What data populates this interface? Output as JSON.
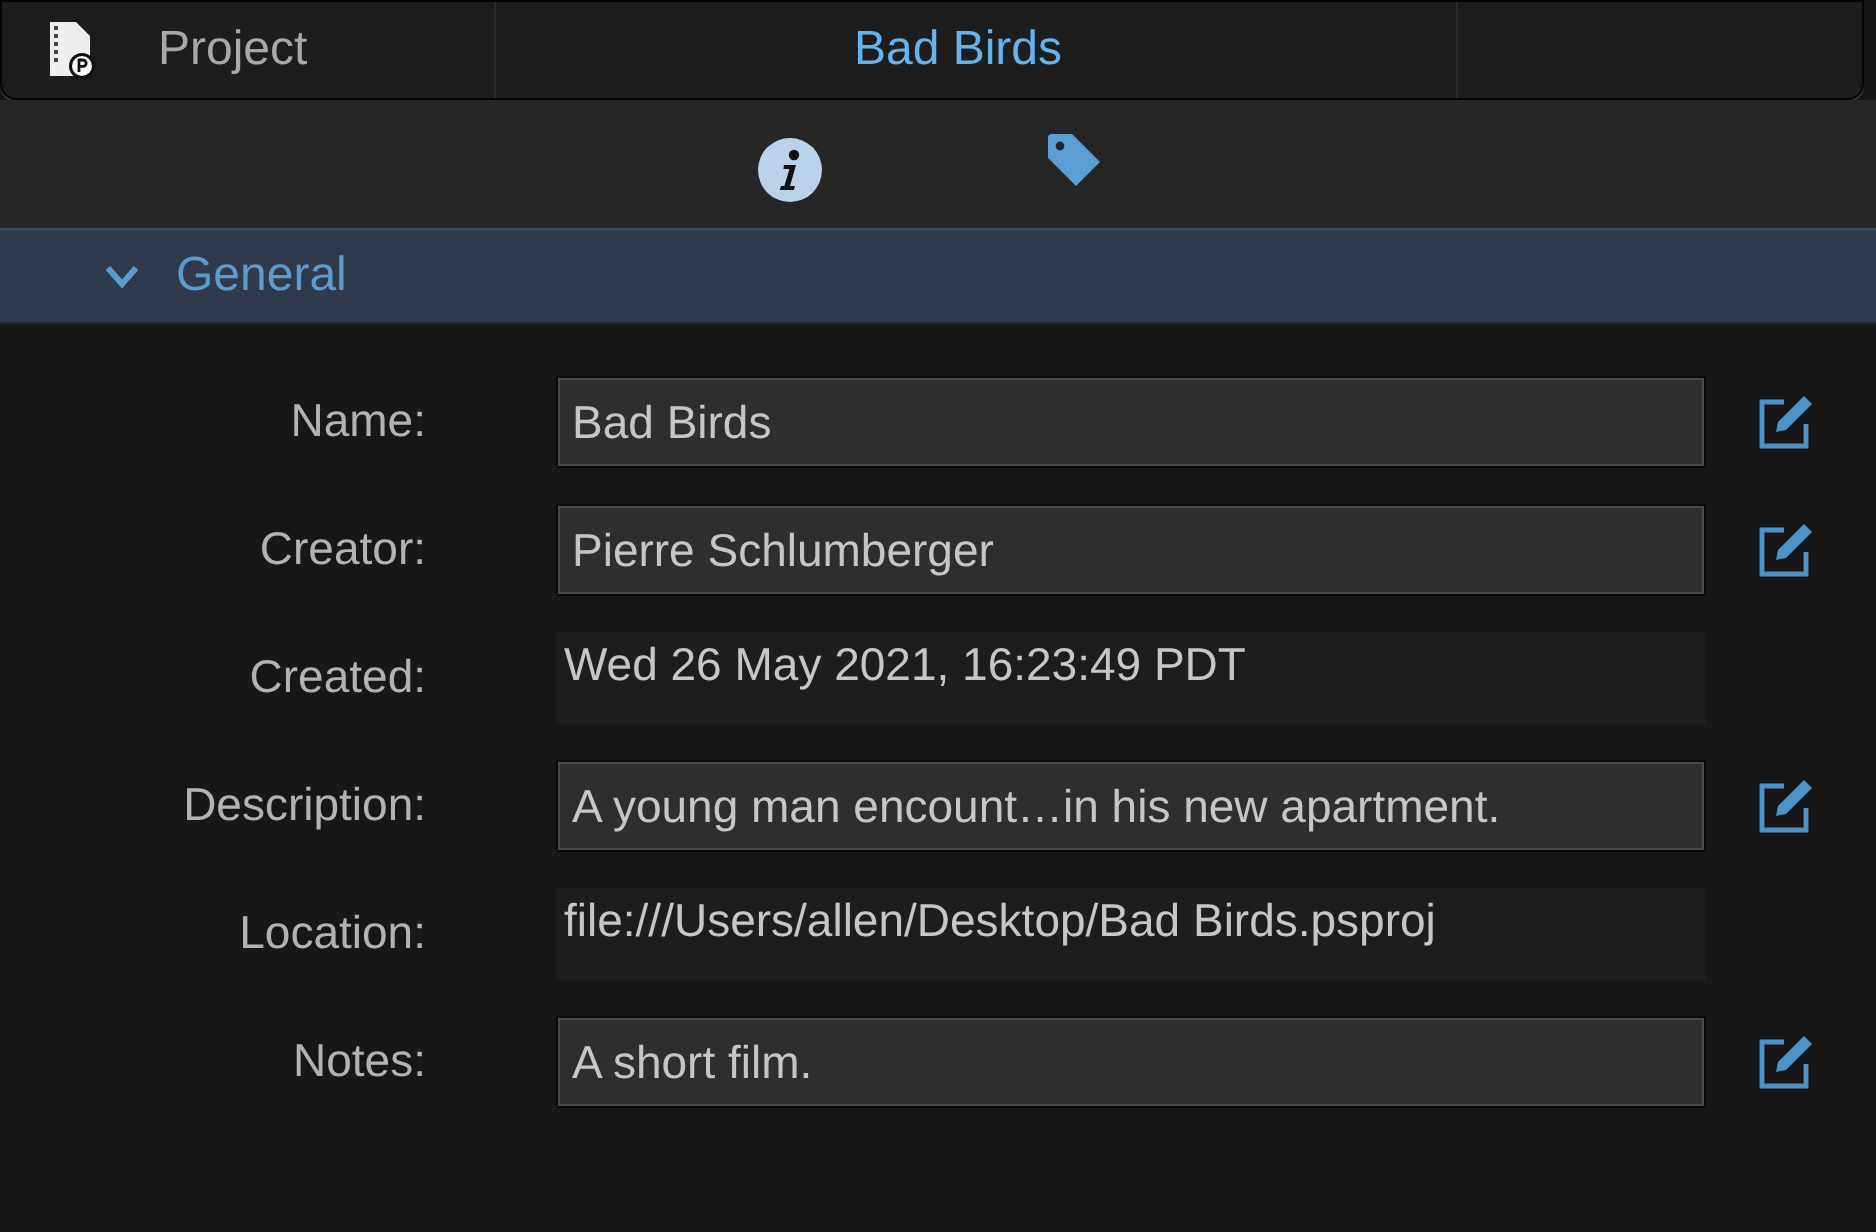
{
  "header": {
    "label": "Project",
    "title": "Bad Birds"
  },
  "section": {
    "title": "General",
    "expanded": true
  },
  "fields": [
    {
      "label": "Name:",
      "value": "Bad Birds",
      "kind": "editable"
    },
    {
      "label": "Creator:",
      "value": "Pierre Schlumberger",
      "kind": "editable"
    },
    {
      "label": "Created:",
      "value": "Wed 26 May 2021, 16:23:49 PDT",
      "kind": "readonly"
    },
    {
      "label": "Description:",
      "value": "A young man encount…in his new apartment.",
      "kind": "editable"
    },
    {
      "label": "Location:",
      "value": "file:///Users/allen/Desktop/Bad Birds.psproj",
      "kind": "readonly"
    },
    {
      "label": "Notes:",
      "value": "A short film.",
      "kind": "editable"
    }
  ]
}
